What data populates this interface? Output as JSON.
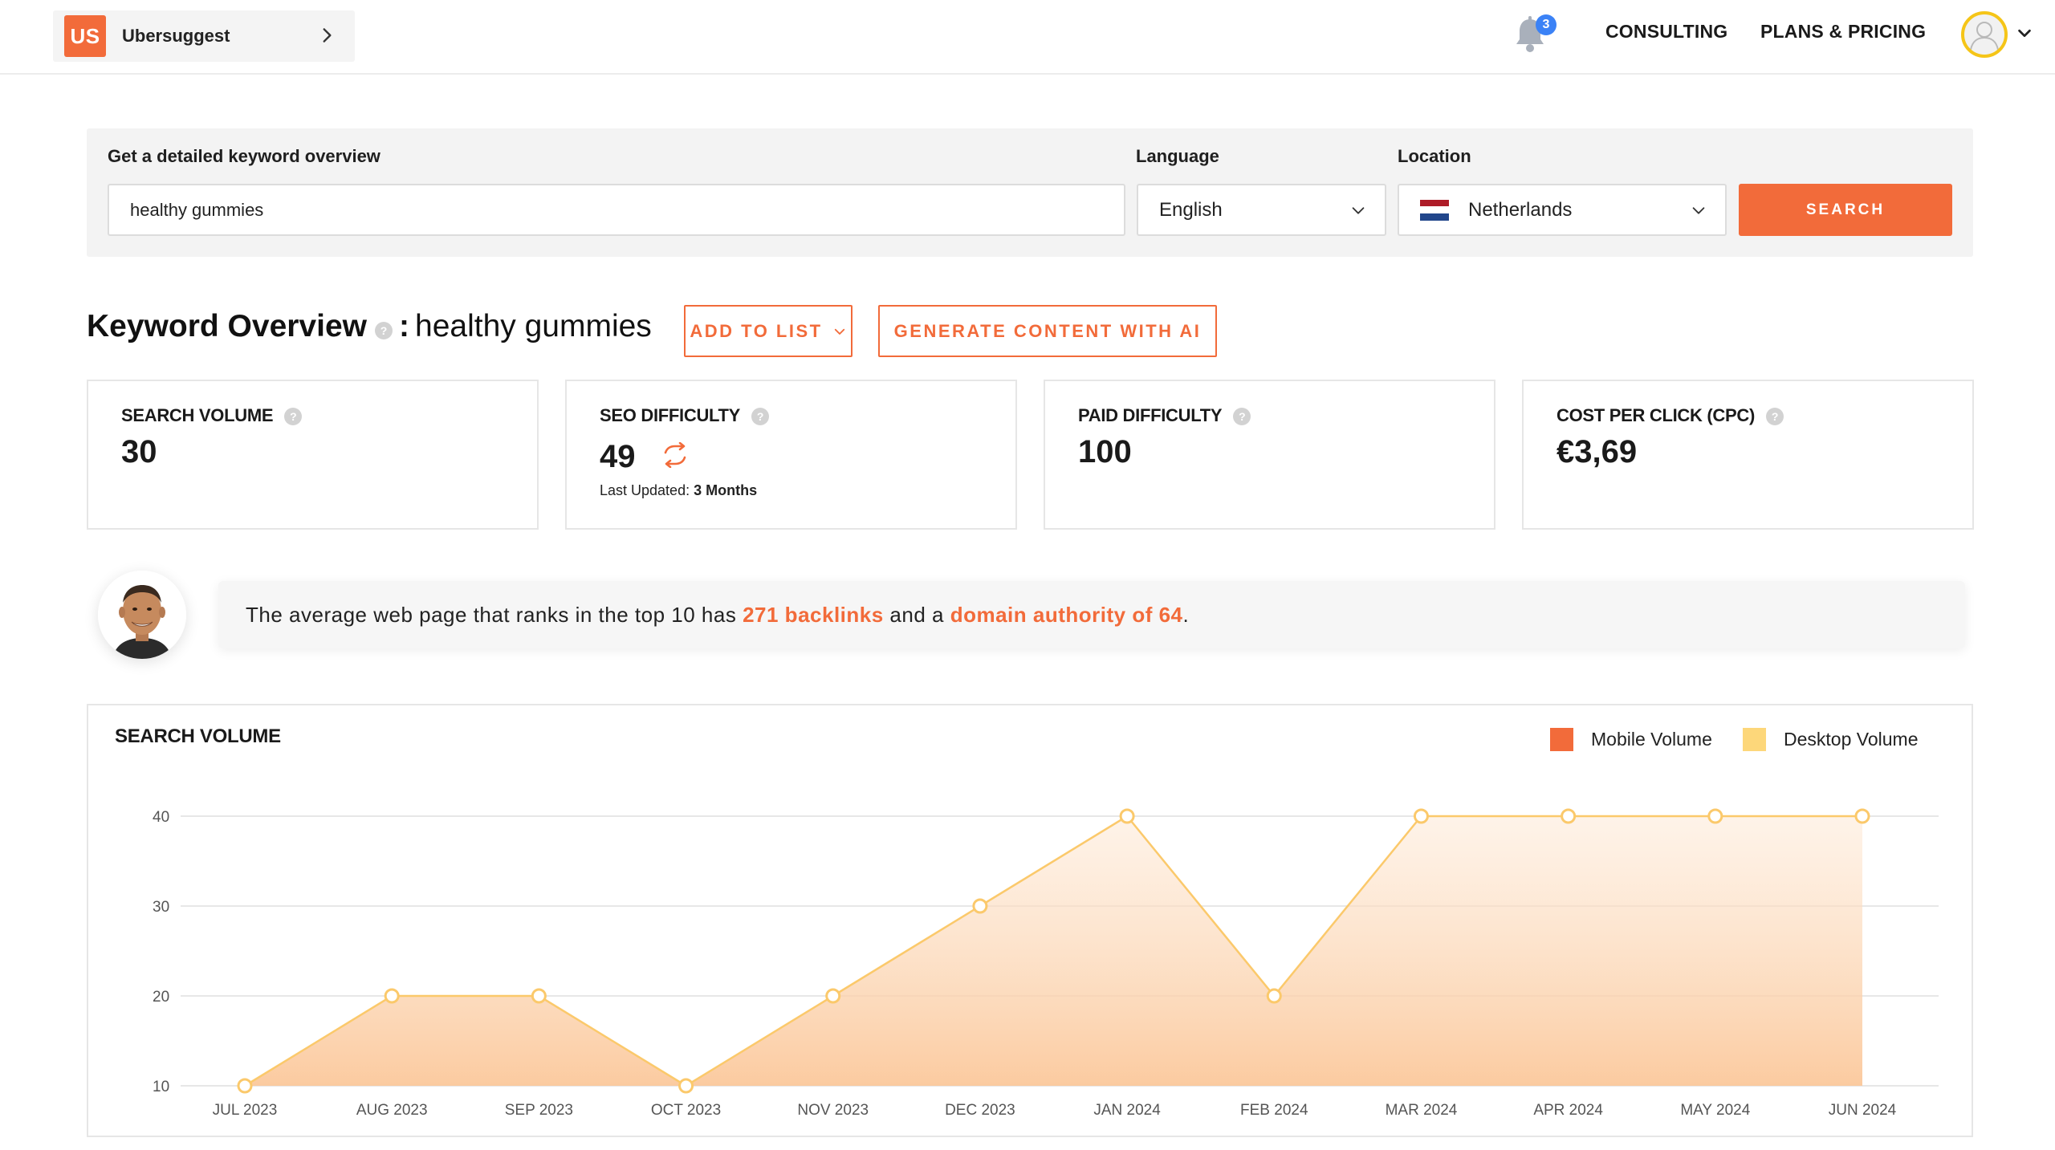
{
  "header": {
    "project_badge": "US",
    "project_name": "Ubersuggest",
    "notification_count": "3",
    "nav": [
      "CONSULTING",
      "PLANS & PRICING"
    ]
  },
  "search": {
    "keyword_label": "Get a detailed keyword overview",
    "keyword_value": "healthy gummies",
    "language_label": "Language",
    "language_value": "English",
    "location_label": "Location",
    "location_value": "Netherlands",
    "search_button": "SEARCH"
  },
  "overview": {
    "title": "Keyword Overview",
    "help": "?",
    "separator": ":",
    "keyword": "healthy gummies",
    "add_to_list": "ADD TO LIST",
    "generate": "GENERATE CONTENT WITH AI"
  },
  "metrics": {
    "search_volume": {
      "label": "SEARCH VOLUME",
      "value": "30"
    },
    "seo_difficulty": {
      "label": "SEO DIFFICULTY",
      "value": "49",
      "updated_label": "Last Updated:",
      "updated_value": "3 Months"
    },
    "paid_difficulty": {
      "label": "PAID DIFFICULTY",
      "value": "100"
    },
    "cpc": {
      "label": "COST PER CLICK (CPC)",
      "value": "€3,69"
    }
  },
  "banner": {
    "text_1": "The average web page that ranks in the top 10 has ",
    "backlinks": "271 backlinks",
    "text_2": " and a ",
    "domain_authority": "domain authority of 64",
    "text_3": "."
  },
  "colors": {
    "accent": "#f26b3a",
    "mobile": "#f26b3a",
    "desktop": "#fdd77a",
    "line": "#fbc96b"
  },
  "chart_data": {
    "type": "area",
    "title": "SEARCH VOLUME",
    "legend": [
      "Mobile Volume",
      "Desktop Volume"
    ],
    "legend_position": "top-right",
    "categories": [
      "JUL 2023",
      "AUG 2023",
      "SEP 2023",
      "OCT 2023",
      "NOV 2023",
      "DEC 2023",
      "JAN 2024",
      "FEB 2024",
      "MAR 2024",
      "APR 2024",
      "MAY 2024",
      "JUN 2024"
    ],
    "series": [
      {
        "name": "Desktop Volume",
        "values": [
          10,
          20,
          20,
          10,
          20,
          30,
          40,
          20,
          40,
          40,
          40,
          40
        ]
      }
    ],
    "yticks": [
      10,
      20,
      30,
      40
    ],
    "ylim": [
      10,
      40
    ],
    "grid": true
  }
}
